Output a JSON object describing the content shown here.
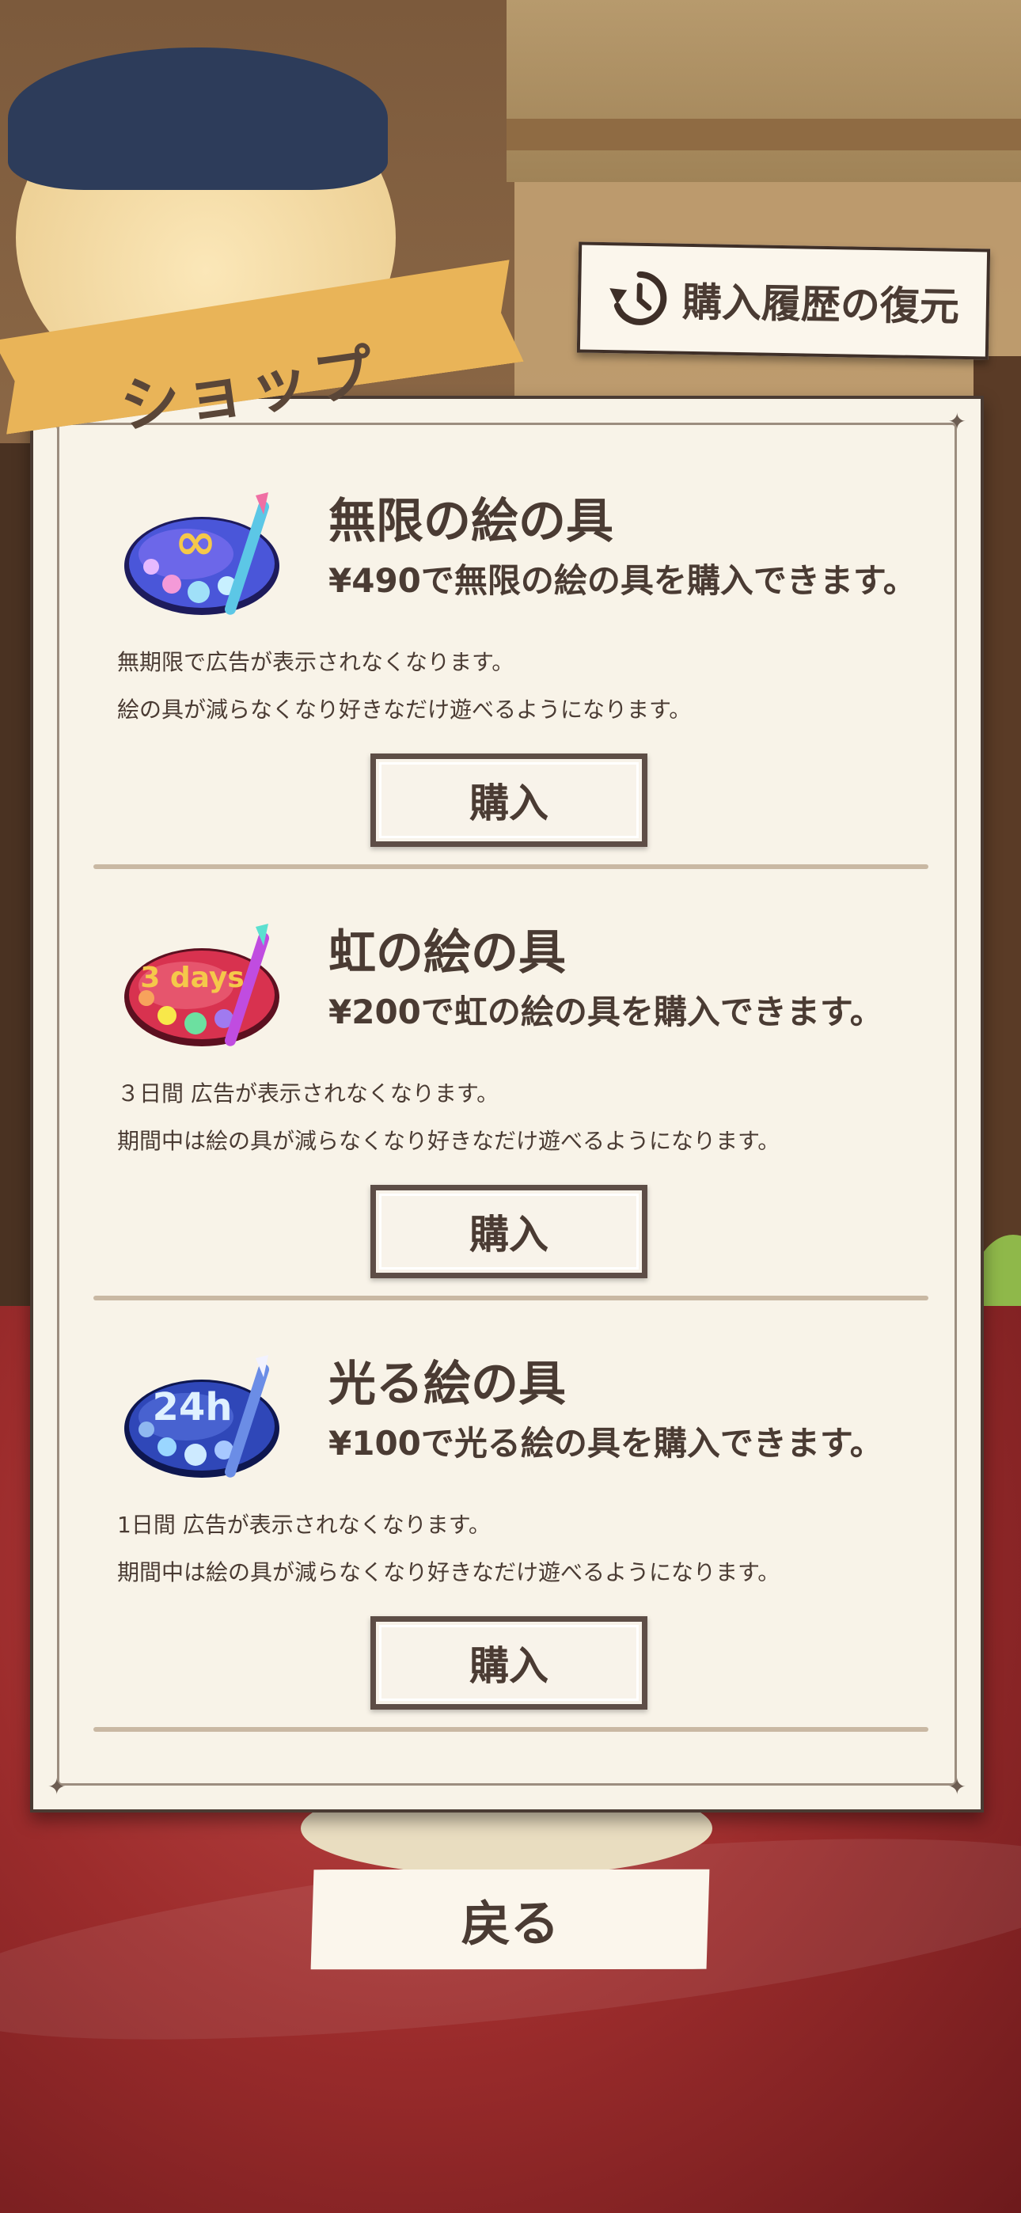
{
  "header": {
    "title": "ショップ",
    "restore_label": "購入履歴の復元"
  },
  "items": [
    {
      "name": "無限の絵の具",
      "price_text": "¥490で無限の絵の具を購入できます。",
      "desc_line1": "無期限で広告が表示されなくなります。",
      "desc_line2": "絵の具が減らなくなり好きなだけ遊べるようになります。",
      "buy_label": "購入",
      "icon": "infinite-paint-palette-icon",
      "icon_badge": "∞",
      "color": "#4a56d9"
    },
    {
      "name": "虹の絵の具",
      "price_text": "¥200で虹の絵の具を購入できます。",
      "desc_line1": "３日間 広告が表示されなくなります。",
      "desc_line2": "期間中は絵の具が減らなくなり好きなだけ遊べるようになります。",
      "buy_label": "購入",
      "icon": "rainbow-paint-palette-icon",
      "icon_badge": "3 days",
      "color": "#d8324f"
    },
    {
      "name": "光る絵の具",
      "price_text": "¥100で光る絵の具を購入できます。",
      "desc_line1": "1日間 広告が表示されなくなります。",
      "desc_line2": "期間中は絵の具が減らなくなり好きなだけ遊べるようになります。",
      "buy_label": "購入",
      "icon": "glowing-paint-palette-icon",
      "icon_badge": "24h",
      "color": "#2f47b8"
    }
  ],
  "footer": {
    "back_label": "戻る"
  }
}
